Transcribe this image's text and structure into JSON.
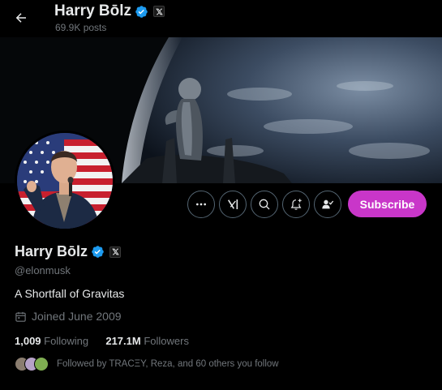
{
  "header": {
    "back_icon": "arrow-left-icon",
    "title": "Harry Bōlz",
    "posts_count": "69.9K posts"
  },
  "profile": {
    "display_name": "Harry Bōlz",
    "handle": "@elonmusk",
    "bio": "A Shortfall of Gravitas",
    "joined": "Joined June 2009",
    "following_count": "1,009",
    "following_label": "Following",
    "followers_count": "217.1M",
    "followers_label": "Followers",
    "followed_by": "Followed by TRACΞY, Reza, and 60 others you follow"
  },
  "actions": {
    "more_icon": "more-icon",
    "grok_icon": "grok-icon",
    "search_icon": "search-icon",
    "notify_icon": "bell-plus-icon",
    "follow_icon": "person-check-icon",
    "subscribe_label": "Subscribe"
  },
  "colors": {
    "background": "#000000",
    "verified": "#1d9bf0",
    "subscribe": "#c936c9",
    "muted_text": "#71767b",
    "text": "#e7e9ea"
  }
}
